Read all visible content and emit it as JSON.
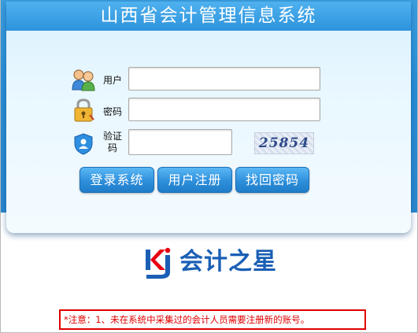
{
  "app": {
    "title": "山西省会计管理信息系统"
  },
  "form": {
    "username": {
      "label": "用户",
      "icon": "users-icon",
      "value": ""
    },
    "password": {
      "label": "密码",
      "icon": "lock-icon",
      "value": ""
    },
    "captcha": {
      "label": "验证码",
      "icon": "shield-icon",
      "value": "",
      "image_text": "25854"
    }
  },
  "buttons": {
    "login": "登录系统",
    "register": "用户注册",
    "recover": "找回密码"
  },
  "brand": {
    "logo_letters": "KJ",
    "name": "会计之星",
    "color": "#1b5fb5",
    "accent": "#e60012"
  },
  "notice": "*注意：1、未在系统中采集过的会计人员需要注册新的账号。",
  "colors": {
    "primary": "#2d93dc",
    "notice": "#e00000"
  }
}
